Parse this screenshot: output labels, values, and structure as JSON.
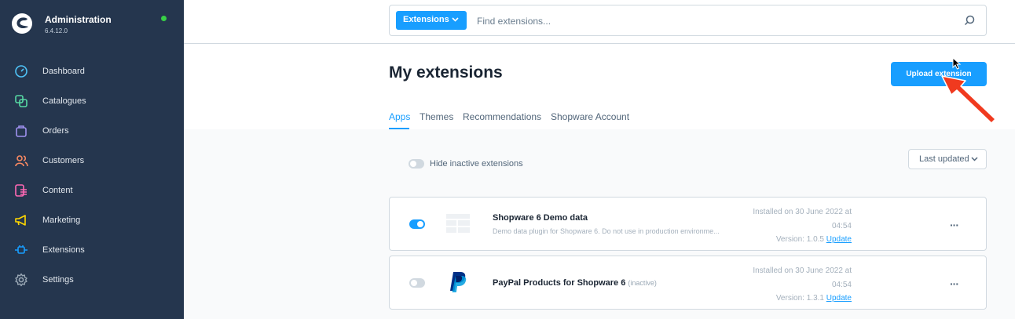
{
  "sidebar": {
    "title": "Administration",
    "version": "6.4.12.0",
    "items": [
      {
        "label": "Dashboard",
        "icon": "dashboard-icon",
        "color": "#4fc3f7"
      },
      {
        "label": "Catalogues",
        "icon": "catalogue-icon",
        "color": "#57d9a3"
      },
      {
        "label": "Orders",
        "icon": "shopping-bag-icon",
        "color": "#a092f0"
      },
      {
        "label": "Customers",
        "icon": "users-icon",
        "color": "#f88962"
      },
      {
        "label": "Content",
        "icon": "content-icon",
        "color": "#ff68b4"
      },
      {
        "label": "Marketing",
        "icon": "megaphone-icon",
        "color": "#ffd700"
      },
      {
        "label": "Extensions",
        "icon": "plug-icon",
        "color": "#189eff"
      },
      {
        "label": "Settings",
        "icon": "gear-icon",
        "color": "#9aa8b5"
      }
    ]
  },
  "search": {
    "type_label": "Extensions",
    "placeholder": "Find extensions..."
  },
  "page": {
    "title": "My extensions",
    "upload_label": "Upload extension"
  },
  "tabs": [
    "Apps",
    "Themes",
    "Recommendations",
    "Shopware Account"
  ],
  "filters": {
    "hide_inactive_label": "Hide inactive extensions",
    "sort_label": "Last updated"
  },
  "extensions": [
    {
      "name": "Shopware 6 Demo data",
      "inactive_label": "",
      "description": "Demo data plugin for Shopware 6. Do not use in production environme...",
      "installed": "Installed on 30 June 2022 at",
      "installed_time": "04:54",
      "version": "Version: 1.0.5",
      "update_label": "Update",
      "active": true,
      "menu": "···"
    },
    {
      "name": "PayPal Products for Shopware 6",
      "inactive_label": "(inactive)",
      "description": "",
      "installed": "Installed on 30 June 2022 at",
      "installed_time": "04:54",
      "version": "Version: 1.3.1",
      "update_label": "Update",
      "active": false,
      "menu": "···"
    }
  ],
  "colors": {
    "accent": "#189eff",
    "sidebar": "#25364e",
    "online": "#37d046",
    "annotation_arrow": "#f03a1f"
  }
}
